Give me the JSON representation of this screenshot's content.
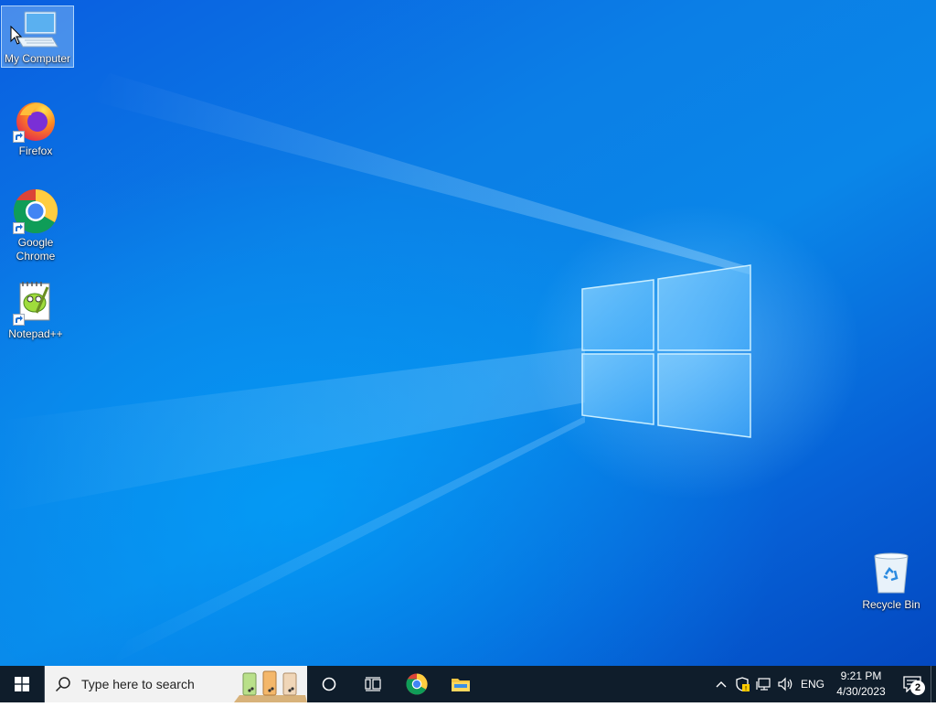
{
  "desktop": {
    "icons": [
      {
        "label": "My Computer",
        "icon": "computer-icon",
        "selected": true
      },
      {
        "label": "Firefox",
        "icon": "firefox-icon",
        "shortcut": true
      },
      {
        "label": "Google Chrome",
        "icon": "chrome-icon",
        "shortcut": true
      },
      {
        "label": "Notepad++",
        "icon": "notepadpp-icon",
        "shortcut": true
      },
      {
        "label": "Recycle Bin",
        "icon": "recycle-bin-icon"
      }
    ]
  },
  "taskbar": {
    "start_icon": "windows-start-icon",
    "search_placeholder": "Type here to search",
    "pinned": [
      {
        "name": "cortana",
        "icon": "cortana-circle-icon"
      },
      {
        "name": "task-view",
        "icon": "task-view-icon"
      },
      {
        "name": "chrome",
        "icon": "chrome-icon"
      },
      {
        "name": "file-explorer",
        "icon": "folder-icon"
      }
    ],
    "tray": {
      "language": "ENG",
      "time": "9:21 PM",
      "date": "4/30/2023",
      "notification_count": "2"
    }
  },
  "colors": {
    "wallpaper": "#0a7fe6",
    "taskbar": "#0f1d2b",
    "search_box": "#f2f2f2"
  }
}
